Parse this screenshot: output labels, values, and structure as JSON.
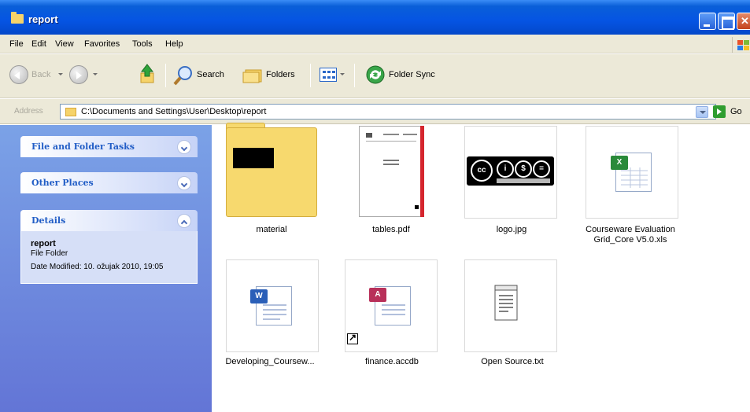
{
  "window": {
    "title": "report"
  },
  "menu": [
    "File",
    "Edit",
    "View",
    "Favorites",
    "Tools",
    "Help"
  ],
  "toolbar": {
    "back_label": "Back",
    "search_label": "Search",
    "folders_label": "Folders",
    "folder_sync_label": "Folder Sync"
  },
  "address": {
    "label": "Address",
    "path": "C:\\Documents and Settings\\User\\Desktop\\report",
    "go_label": "Go"
  },
  "taskpane": {
    "file_folder_tasks": "File and Folder Tasks",
    "other_places": "Other Places",
    "details": "Details",
    "detail_name": "report",
    "detail_type": "File Folder",
    "detail_modified": "Date Modified: 10. ožujak 2010, 19:05"
  },
  "files": [
    {
      "name": "material",
      "icon": "folder-icon"
    },
    {
      "name": "tables.pdf",
      "icon": "pdf-thumbnail"
    },
    {
      "name": "logo.jpg",
      "icon": "cc-logo-thumbnail"
    },
    {
      "name": "Courseware Evaluation Grid_Core V5.0.xls",
      "icon": "excel-icon"
    },
    {
      "name": "Developing_Coursew...",
      "icon": "word-icon"
    },
    {
      "name": "finance.accdb",
      "icon": "access-icon"
    },
    {
      "name": "Open Source.txt",
      "icon": "text-file-icon"
    }
  ],
  "colors": {
    "title_bar": "#0554e3",
    "taskpane": "#6f8ce0",
    "toolbar": "#ece9d8",
    "link": "#215dc6"
  }
}
